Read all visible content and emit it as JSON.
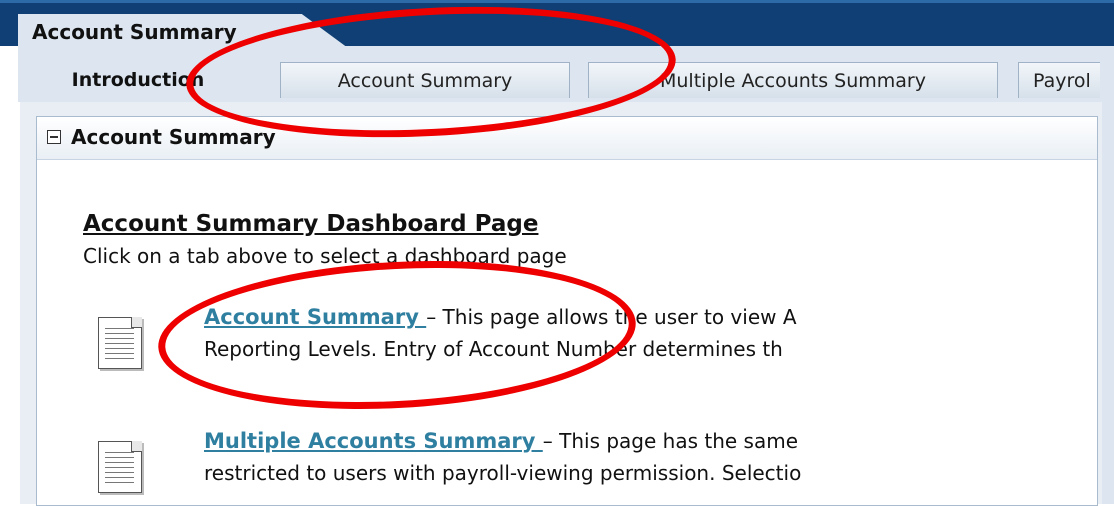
{
  "header": {
    "title_tab": "Account Summary"
  },
  "tabs": [
    {
      "label": "Introduction",
      "active": true
    },
    {
      "label": "Account Summary",
      "active": false
    },
    {
      "label": "Multiple Accounts Summary",
      "active": false
    },
    {
      "label": "Payrol",
      "active": false
    }
  ],
  "panel": {
    "title": "Account Summary",
    "heading": "Account Summary Dashboard Page",
    "subheading": "Click on a tab above to select a dashboard page",
    "items": [
      {
        "link": "Account Summary ",
        "line1": " – This page allows the user to view A",
        "line2": "Reporting Levels. Entry of Account Number determines th"
      },
      {
        "link": "Multiple Accounts Summary ",
        "line1": " – This page has the same",
        "line2": "restricted to users with payroll-viewing permission. Selectio"
      }
    ]
  },
  "colors": {
    "header_band": "#0f3f74",
    "annotation": "#ee0000",
    "link": "#2f7fa1"
  }
}
